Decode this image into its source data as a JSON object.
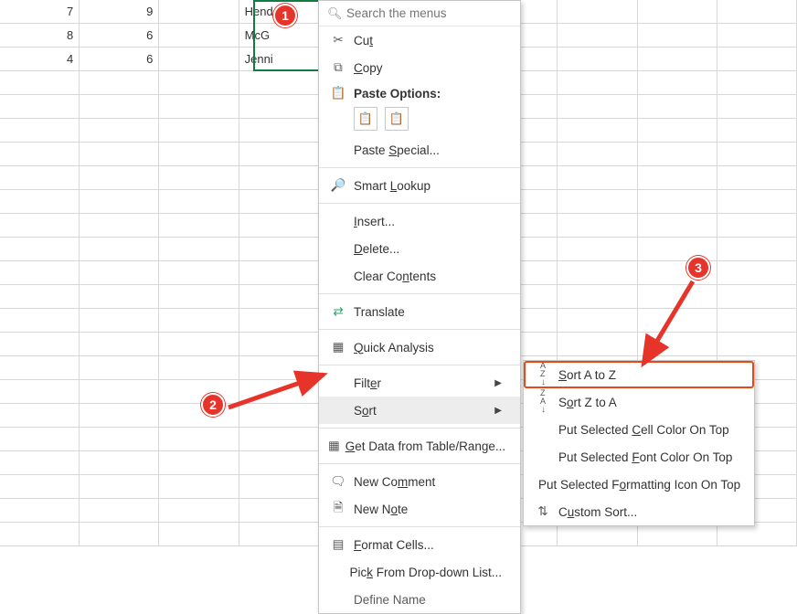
{
  "annotations": {
    "b1": "1",
    "b2": "2",
    "b3": "3"
  },
  "grid": {
    "r1c1": "7",
    "r1c2": "9",
    "r1c4": "Hend",
    "r2c1": "8",
    "r2c2": "6",
    "r2c4": "McG",
    "r3c1": "4",
    "r3c2": "6",
    "r3c4": "Jenni"
  },
  "search": {
    "placeholder": "Search the menus"
  },
  "menu": {
    "cut": {
      "label_pre": "Cu",
      "u": "t",
      "label_post": ""
    },
    "copy": {
      "label_pre": "",
      "u": "C",
      "label_post": "opy"
    },
    "paste_options": "Paste Options:",
    "paste_special": {
      "pre": "Paste ",
      "u": "S",
      "post": "pecial..."
    },
    "smart_lookup": {
      "pre": "Smart ",
      "u": "L",
      "post": "ookup"
    },
    "insert": {
      "pre": "",
      "u": "I",
      "post": "nsert..."
    },
    "delete": {
      "pre": "",
      "u": "D",
      "post": "elete..."
    },
    "clear": {
      "pre": "Clear Co",
      "u": "n",
      "post": "tents"
    },
    "translate": "Translate",
    "quick": {
      "pre": "",
      "u": "Q",
      "post": "uick Analysis"
    },
    "filter": {
      "pre": "Filt",
      "u": "e",
      "post": "r"
    },
    "sort": {
      "pre": "S",
      "u": "o",
      "post": "rt"
    },
    "getdata": {
      "pre": "",
      "u": "G",
      "post": "et Data from Table/Range..."
    },
    "newcomment": {
      "pre": "New Co",
      "u": "m",
      "post": "ment"
    },
    "newnote": {
      "pre": "New N",
      "u": "o",
      "post": "te"
    },
    "formatcells": {
      "pre": "",
      "u": "F",
      "post": "ormat Cells..."
    },
    "pickfrom": {
      "pre": "Pic",
      "u": "k",
      "post": " From Drop-down List..."
    },
    "definename": "Define Name"
  },
  "submenu": {
    "az": {
      "pre": "",
      "u": "S",
      "post": "ort A to Z"
    },
    "za": {
      "pre": "S",
      "u": "o",
      "post": "rt Z to A"
    },
    "cell": {
      "pre": "Put Selected ",
      "u": "C",
      "post": "ell Color On Top"
    },
    "font": {
      "pre": "Put Selected ",
      "u": "F",
      "post": "ont Color On Top"
    },
    "fmt": {
      "pre": "Put Selected F",
      "u": "o",
      "post": "rmatting Icon On Top"
    },
    "custom": {
      "pre": "C",
      "u": "u",
      "post": "stom Sort..."
    }
  },
  "sorticon_az": {
    "l1": "A",
    "l2": "Z"
  },
  "sorticon_za": {
    "l1": "Z",
    "l2": "A"
  }
}
